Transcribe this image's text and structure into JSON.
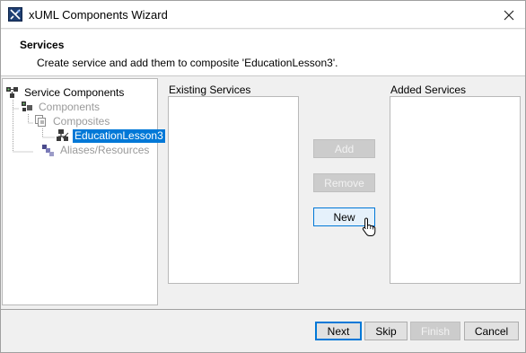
{
  "window": {
    "title": "xUML Components Wizard"
  },
  "header": {
    "title": "Services",
    "subtitle": "Create service and add them to composite 'EducationLesson3'."
  },
  "tree": {
    "items": [
      {
        "label": "Service Components",
        "icon": "service-components-icon",
        "state": "normal"
      },
      {
        "label": "Components",
        "icon": "components-icon",
        "state": "disabled"
      },
      {
        "label": "Composites",
        "icon": "composites-icon",
        "state": "disabled"
      },
      {
        "label": "EducationLesson3",
        "icon": "composite-node-icon",
        "state": "selected"
      },
      {
        "label": "Aliases/Resources",
        "icon": "aliases-icon",
        "state": "disabled"
      }
    ]
  },
  "services": {
    "existing_label": "Existing Services",
    "added_label": "Added Services",
    "existing_items": [],
    "added_items": []
  },
  "actions": {
    "add_label": "Add",
    "remove_label": "Remove",
    "new_label": "New"
  },
  "footer": {
    "next_label": "Next",
    "skip_label": "Skip",
    "finish_label": "Finish",
    "cancel_label": "Cancel"
  },
  "colors": {
    "selection": "#0078d7",
    "disabled_text": "#9a9a9a",
    "hover_button": "#e5f1fb"
  }
}
